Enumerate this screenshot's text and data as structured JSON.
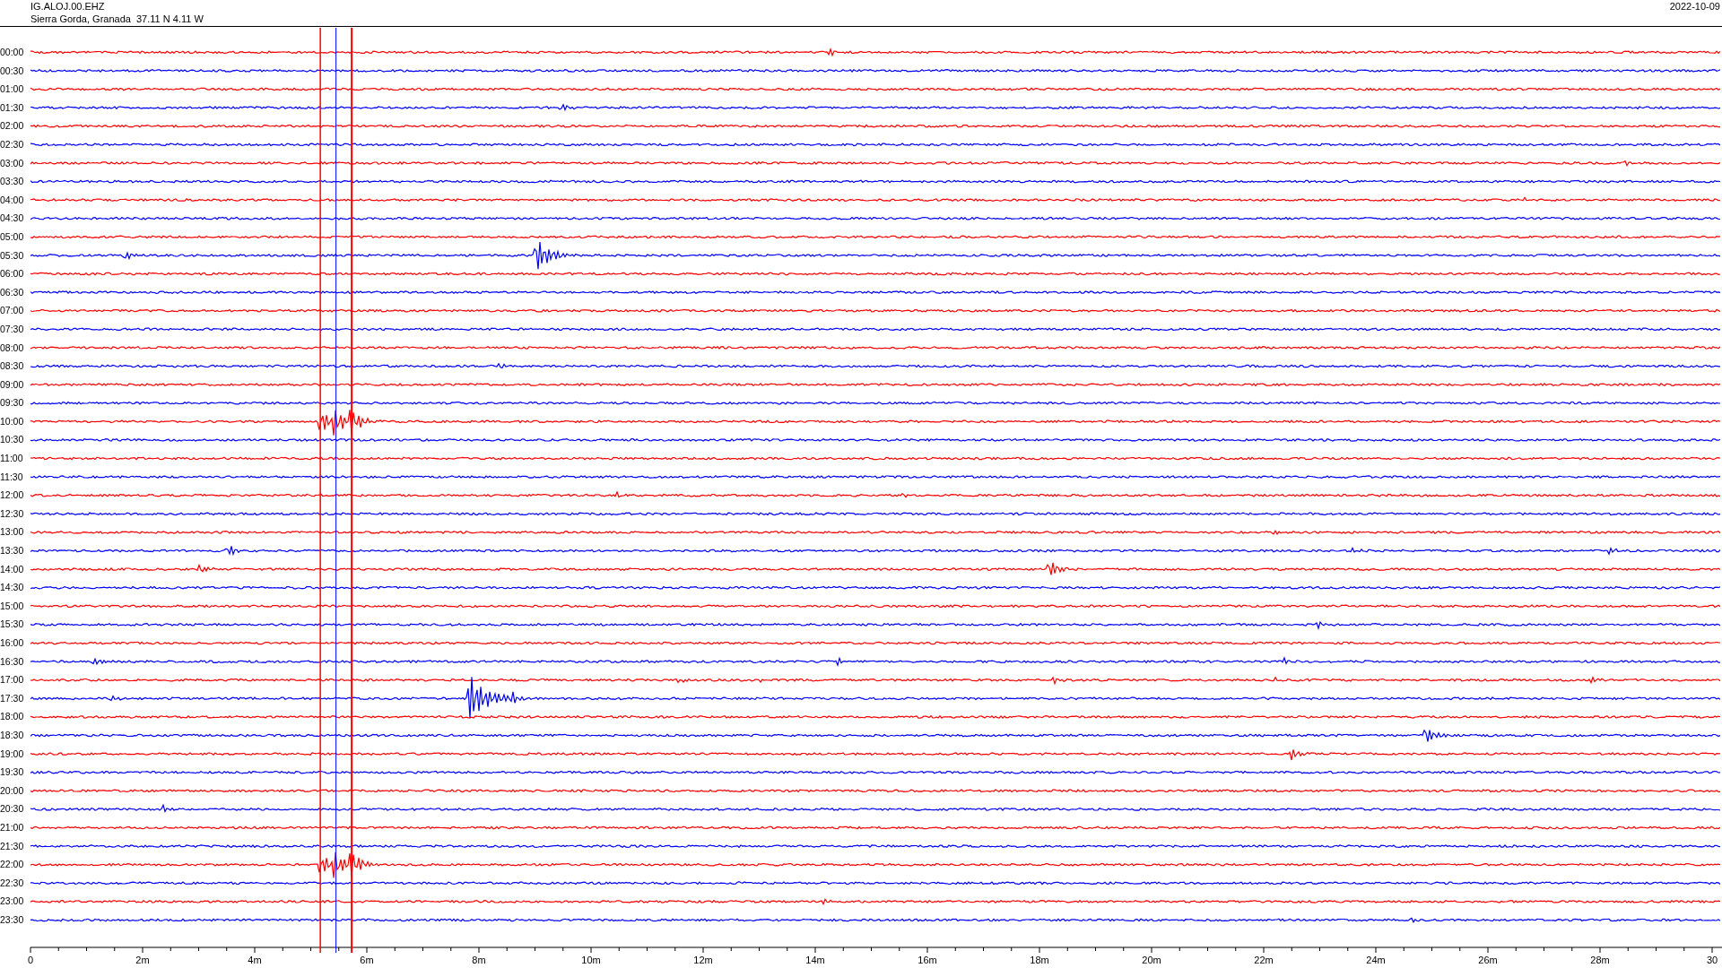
{
  "header": {
    "station": "IG.ALOJ.00.EHZ",
    "location": "Sierra Gorda, Granada  37.11 N 4.11 W",
    "date": "2022-10-09"
  },
  "rows": [
    {
      "time": "00:00",
      "color": "#ff0000"
    },
    {
      "time": "00:30",
      "color": "#0000ff"
    },
    {
      "time": "01:00",
      "color": "#ff0000"
    },
    {
      "time": "01:30",
      "color": "#0000ff"
    },
    {
      "time": "02:00",
      "color": "#ff0000"
    },
    {
      "time": "02:30",
      "color": "#0000ff"
    },
    {
      "time": "03:00",
      "color": "#ff0000"
    },
    {
      "time": "03:30",
      "color": "#0000ff"
    },
    {
      "time": "04:00",
      "color": "#ff0000"
    },
    {
      "time": "04:30",
      "color": "#0000ff"
    },
    {
      "time": "05:00",
      "color": "#ff0000"
    },
    {
      "time": "05:30",
      "color": "#0000ff"
    },
    {
      "time": "06:00",
      "color": "#ff0000"
    },
    {
      "time": "06:30",
      "color": "#0000ff"
    },
    {
      "time": "07:00",
      "color": "#ff0000"
    },
    {
      "time": "07:30",
      "color": "#0000ff"
    },
    {
      "time": "08:00",
      "color": "#ff0000"
    },
    {
      "time": "08:30",
      "color": "#0000ff"
    },
    {
      "time": "09:00",
      "color": "#ff0000"
    },
    {
      "time": "09:30",
      "color": "#0000ff"
    },
    {
      "time": "10:00",
      "color": "#ff0000"
    },
    {
      "time": "10:30",
      "color": "#0000ff"
    },
    {
      "time": "11:00",
      "color": "#ff0000"
    },
    {
      "time": "11:30",
      "color": "#0000ff"
    },
    {
      "time": "12:00",
      "color": "#ff0000"
    },
    {
      "time": "12:30",
      "color": "#0000ff"
    },
    {
      "time": "13:00",
      "color": "#ff0000"
    },
    {
      "time": "13:30",
      "color": "#0000ff"
    },
    {
      "time": "14:00",
      "color": "#ff0000"
    },
    {
      "time": "14:30",
      "color": "#0000ff"
    },
    {
      "time": "15:00",
      "color": "#ff0000"
    },
    {
      "time": "15:30",
      "color": "#0000ff"
    },
    {
      "time": "16:00",
      "color": "#ff0000"
    },
    {
      "time": "16:30",
      "color": "#0000ff"
    },
    {
      "time": "17:00",
      "color": "#ff0000"
    },
    {
      "time": "17:30",
      "color": "#0000ff"
    },
    {
      "time": "18:00",
      "color": "#ff0000"
    },
    {
      "time": "18:30",
      "color": "#0000ff"
    },
    {
      "time": "19:00",
      "color": "#ff0000"
    },
    {
      "time": "19:30",
      "color": "#0000ff"
    },
    {
      "time": "20:00",
      "color": "#ff0000"
    },
    {
      "time": "20:30",
      "color": "#0000ff"
    },
    {
      "time": "21:00",
      "color": "#ff0000"
    },
    {
      "time": "21:30",
      "color": "#0000ff"
    },
    {
      "time": "22:00",
      "color": "#ff0000"
    },
    {
      "time": "22:30",
      "color": "#0000ff"
    },
    {
      "time": "23:00",
      "color": "#ff0000"
    },
    {
      "time": "23:30",
      "color": "#0000ff"
    }
  ],
  "x_axis": {
    "labels": [
      "0",
      "2m",
      "4m",
      "6m",
      "8m",
      "10m",
      "12m",
      "14m",
      "16m",
      "18m",
      "20m",
      "22m",
      "24m",
      "26m",
      "28m",
      "30"
    ]
  }
}
